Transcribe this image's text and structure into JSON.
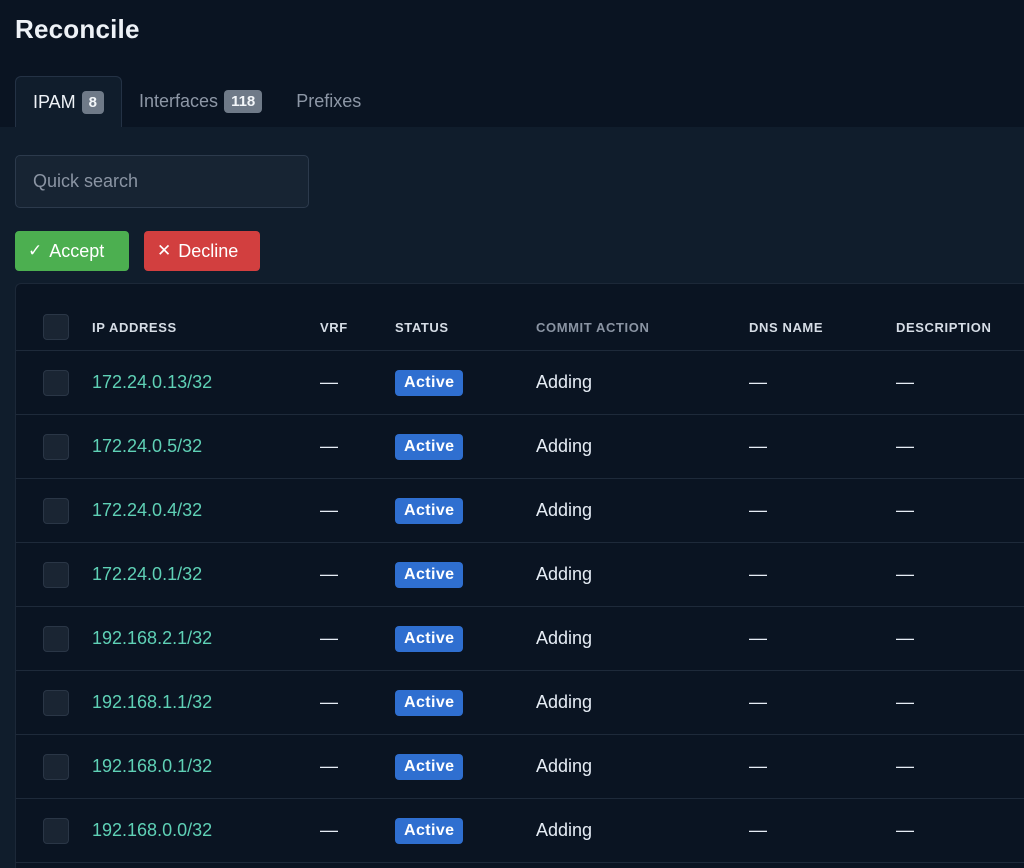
{
  "page": {
    "title": "Reconcile"
  },
  "tabs": [
    {
      "label": "IPAM",
      "count": "8",
      "active": true
    },
    {
      "label": "Interfaces",
      "count": "118",
      "active": false
    },
    {
      "label": "Prefixes",
      "count": "",
      "active": false
    }
  ],
  "search": {
    "placeholder": "Quick search",
    "value": ""
  },
  "actions": {
    "accept_label": "Accept",
    "decline_label": "Decline"
  },
  "table": {
    "columns": [
      "IP ADDRESS",
      "VRF",
      "STATUS",
      "COMMIT ACTION",
      "DNS NAME",
      "DESCRIPTION"
    ],
    "rows": [
      {
        "ip": "172.24.0.13/32",
        "vrf": "—",
        "status": "Active",
        "action": "Adding",
        "dns": "—",
        "description": "—"
      },
      {
        "ip": "172.24.0.5/32",
        "vrf": "—",
        "status": "Active",
        "action": "Adding",
        "dns": "—",
        "description": "—"
      },
      {
        "ip": "172.24.0.4/32",
        "vrf": "—",
        "status": "Active",
        "action": "Adding",
        "dns": "—",
        "description": "—"
      },
      {
        "ip": "172.24.0.1/32",
        "vrf": "—",
        "status": "Active",
        "action": "Adding",
        "dns": "—",
        "description": "—"
      },
      {
        "ip": "192.168.2.1/32",
        "vrf": "—",
        "status": "Active",
        "action": "Adding",
        "dns": "—",
        "description": "—"
      },
      {
        "ip": "192.168.1.1/32",
        "vrf": "—",
        "status": "Active",
        "action": "Adding",
        "dns": "—",
        "description": "—"
      },
      {
        "ip": "192.168.0.1/32",
        "vrf": "—",
        "status": "Active",
        "action": "Adding",
        "dns": "—",
        "description": "—"
      },
      {
        "ip": "192.168.0.0/32",
        "vrf": "—",
        "status": "Active",
        "action": "Adding",
        "dns": "—",
        "description": "—"
      }
    ]
  },
  "colors": {
    "background": "#0a1422",
    "panel": "#101d2c",
    "accept": "#4caf50",
    "decline": "#d23f3f",
    "status_active": "#2f6fd0",
    "link": "#5fd1b6"
  },
  "icons": {
    "accept": "check-icon",
    "decline": "close-icon"
  }
}
